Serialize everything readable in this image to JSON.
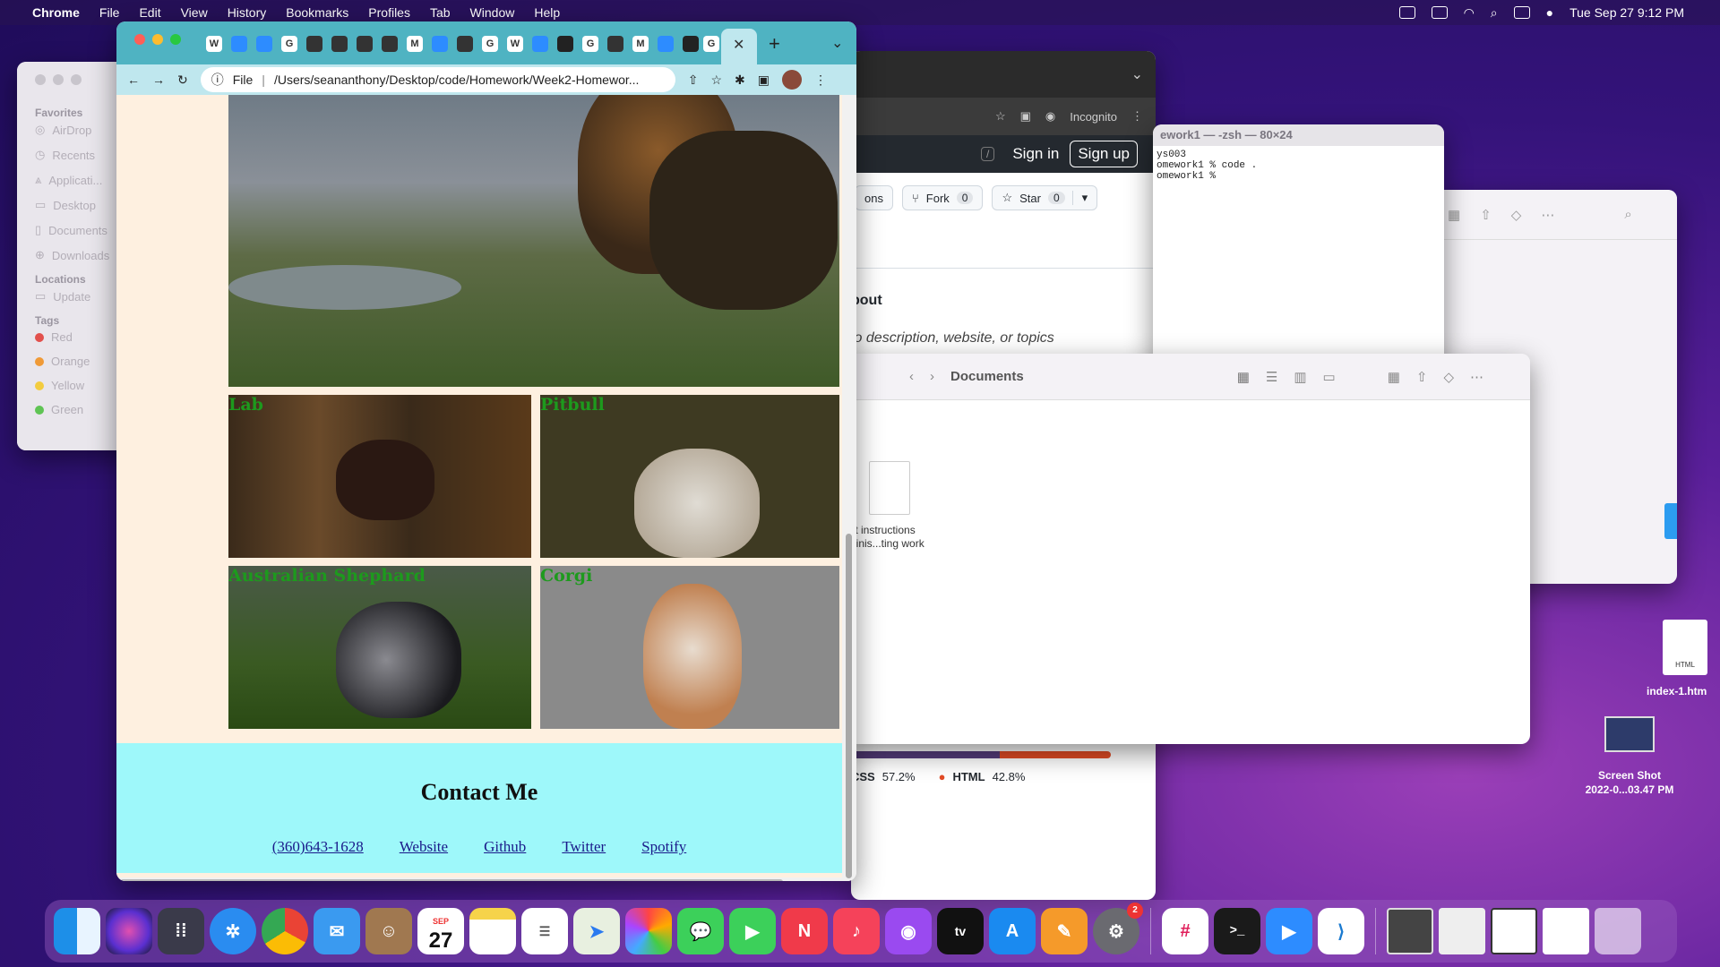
{
  "menubar": {
    "app": "Chrome",
    "items": [
      "File",
      "Edit",
      "View",
      "History",
      "Bookmarks",
      "Profiles",
      "Tab",
      "Window",
      "Help"
    ],
    "clock": "Tue Sep 27  9:12 PM"
  },
  "finder_back": {
    "favorites_header": "Favorites",
    "favorites": [
      "AirDrop",
      "Recents",
      "Applicati...",
      "Desktop",
      "Documents",
      "Downloads"
    ],
    "locations_header": "Locations",
    "locations": [
      "Update"
    ],
    "tags_header": "Tags",
    "tags": [
      {
        "label": "Red",
        "color": "#e2504c"
      },
      {
        "label": "Orange",
        "color": "#f09a37"
      },
      {
        "label": "Yellow",
        "color": "#f3cc3f"
      },
      {
        "label": "Green",
        "color": "#5fc454"
      }
    ]
  },
  "github": {
    "incognito": "Incognito",
    "sign_in": "Sign in",
    "sign_up": "Sign up",
    "slash": "/",
    "btn_partial": "ons",
    "fork_label": "Fork",
    "fork_count": "0",
    "star_label": "Star",
    "star_count": "0",
    "about": "bout",
    "desc": "lo description, website, or topics",
    "lang_css": "CSS",
    "lang_css_pct": "57.2%",
    "lang_html": "HTML",
    "lang_html_pct": "42.8%"
  },
  "terminal": {
    "title": "ework1 — -zsh — 80×24",
    "lines": "ys003\nomework1 % code .\nomework1 % "
  },
  "finder_docs": {
    "title": "Documents",
    "file_label": "git instructions\nr finis...ting work"
  },
  "desktop": {
    "html_file": "index-1.htm",
    "html_badge": "HTML",
    "screenshot": "Screen Shot\n2022-0...03.47 PM"
  },
  "chrome": {
    "url_scheme": "File",
    "url": "/Users/seananthony/Desktop/code/Homework/Week2-Homewor..."
  },
  "page": {
    "captions": [
      "Lab",
      "Pitbull",
      "Australian Shephard",
      "Corgi"
    ],
    "contact_title": "Contact Me",
    "links": [
      "(360)643-1628",
      "Website",
      "Github",
      "Twitter",
      "Spotify"
    ]
  },
  "dock": {
    "calendar_month": "SEP",
    "calendar_day": "27",
    "settings_badge": "2"
  }
}
